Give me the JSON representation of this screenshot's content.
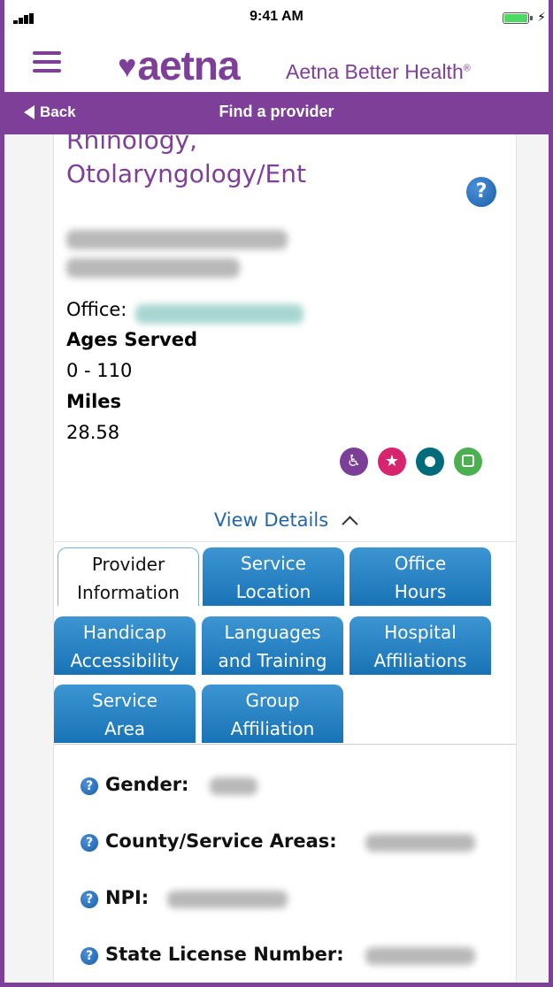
{
  "status_bar": {
    "time": "9:41 AM"
  },
  "header": {
    "logo_text": "aetna",
    "logo_heart": "♥",
    "subtitle": "Aetna Better Health",
    "subtitle_mark": "®"
  },
  "nav": {
    "back_label": "Back",
    "title": "Find a provider"
  },
  "provider": {
    "specialty_line1": "Rhinology,",
    "specialty_line2": "Otolaryngology/Ent",
    "office_label": "Office:",
    "ages_label": "Ages Served",
    "ages_value": "0 - 110",
    "miles_label": "Miles",
    "miles_value": "28.58",
    "feature_icons": [
      "handicap-accessible-icon",
      "star-icon",
      "circle-icon",
      "bus-icon"
    ],
    "view_details": "View Details"
  },
  "tabs": [
    {
      "line1": "Provider",
      "line2": "Information",
      "active": true
    },
    {
      "line1": "Service",
      "line2": "Location",
      "active": false
    },
    {
      "line1": "Office",
      "line2": "Hours",
      "active": false
    },
    {
      "line1": "Handicap",
      "line2": "Accessibility",
      "active": false
    },
    {
      "line1": "Languages",
      "line2": "and Training",
      "active": false
    },
    {
      "line1": "Hospital",
      "line2": "Affiliations",
      "active": false
    },
    {
      "line1": "Service",
      "line2": "Area",
      "active": false
    },
    {
      "line1": "Group",
      "line2": "Affiliation",
      "active": false
    }
  ],
  "details": {
    "gender_label": "Gender:",
    "county_label": "County/Service Areas:",
    "npi_label": "NPI:",
    "license_label": "State License Number:"
  },
  "colors": {
    "brand_purple": "#7e3f98",
    "tab_blue": "#1873b6",
    "link_blue": "#2266a8",
    "feature_purple": "#7b3f98",
    "feature_pink": "#d6246e",
    "feature_teal": "#006b7a",
    "feature_green": "#4caf50"
  }
}
